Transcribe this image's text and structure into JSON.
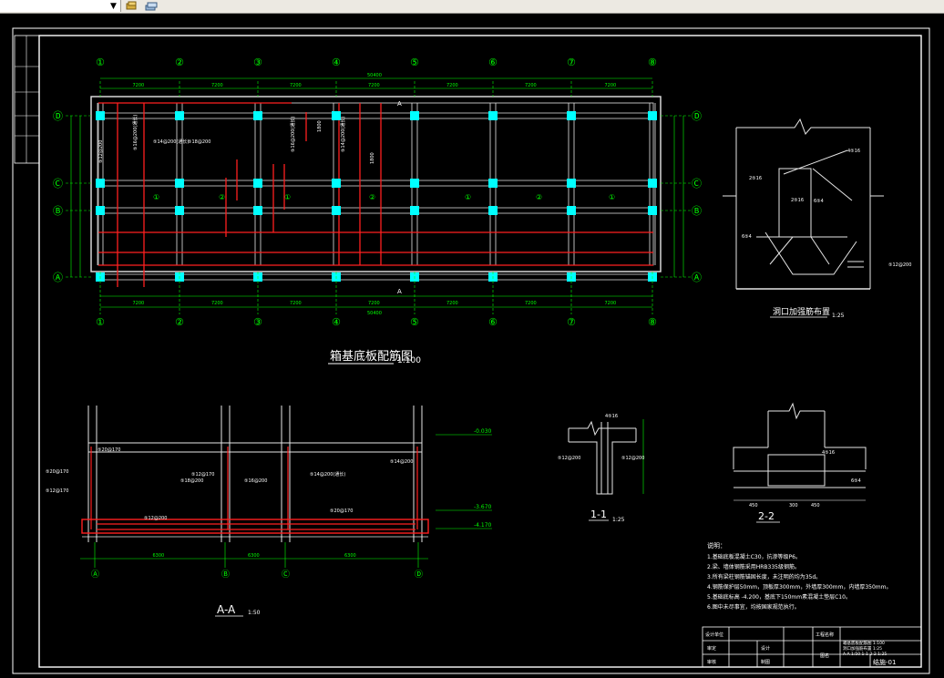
{
  "toolbar": {
    "combo_value": "",
    "icons": [
      "layer-icon",
      "layer-stack-icon"
    ]
  },
  "drawing": {
    "plan_title": "箱基底板配筋图",
    "plan_scale": "1:100",
    "axes_top": [
      "①",
      "②",
      "③",
      "④",
      "⑤",
      "⑥",
      "⑦",
      "⑧"
    ],
    "axes_side": [
      "Ⓓ",
      "Ⓒ",
      "Ⓑ",
      "Ⓐ"
    ],
    "plan_dims_top": [
      "7200",
      "7200",
      "7200",
      "7200",
      "7200",
      "7200",
      "7200"
    ],
    "plan_total_top": "50400",
    "plan_labels": [
      "⑤12@200",
      "⑤16@200(通长)",
      "⑤14@200(通长)",
      "⑤18@200",
      "⑤16@200(通长)",
      "⑤14@200(通长)",
      "1800",
      "1800"
    ],
    "panel_marks": [
      "①",
      "②",
      "①",
      "②",
      "①",
      "②",
      "①"
    ],
    "section_aa_title": "A-A",
    "section_aa_scale": "1:50",
    "section_aa_labels": [
      "⑤20@170",
      "⑤20@170",
      "⑤12@170",
      "⑤12@170",
      "⑤18@200",
      "⑤16@200",
      "⑤14@200(通长)",
      "⑤14@200",
      "⑤12@200",
      "⑤20@170"
    ],
    "section_aa_levels": [
      "-0.030",
      "-3.670",
      "-4.170"
    ],
    "section_aa_dims": [
      "6300",
      "6300",
      "6300"
    ],
    "section_aa_axes": [
      "Ⓐ",
      "Ⓑ",
      "Ⓒ",
      "Ⓓ"
    ],
    "detail_opening_title": "洞口加强筋布置",
    "detail_opening_scale": "1:25",
    "detail_opening_labels": [
      "4⑤16",
      "2⑤16",
      "2⑤16",
      "6⑤4",
      "6⑤4",
      "⑤12@200"
    ],
    "detail_11_title": "1-1",
    "detail_11_scale": "1:25",
    "detail_11_labels": [
      "4⑤16",
      "⑤12@200",
      "⑤12@200"
    ],
    "detail_22_title": "2-2",
    "detail_22_scale": "1:25",
    "detail_22_labels": [
      "4⑤16",
      "6⑤4"
    ],
    "detail_22_dims": [
      "450",
      "300",
      "450"
    ],
    "notes_title": "说明：",
    "notes": [
      "1.基础底板混凝土C30，抗渗等级P6。",
      "2.梁、墙体钢筋采用HRB335级钢筋。",
      "3.所有梁柱钢筋锚固长度，未注明的均为35d。",
      "4.钢筋保护层50mm，顶板厚300mm，外墙厚300mm，内墙厚350mm。",
      "5.基础底标高 -4.200，基底下150mm素混凝土垫层C10。",
      "6.图中未尽事宜，均按国家规范执行。"
    ],
    "titleblock": {
      "row1": [
        "设计单位",
        "",
        "",
        "工程名称"
      ],
      "row2": [
        "审定",
        "",
        "设计",
        "",
        "图名"
      ],
      "row3": [
        "审核",
        "",
        "制图",
        "",
        "",
        "图号"
      ],
      "drawing_name": [
        "箱基底板配筋图 1:100",
        "洞口加强筋布置 1:25",
        "A-A 1:50  1-1 2-2 1:25"
      ],
      "drawing_no": "结施-01"
    }
  },
  "colors": {
    "grid": "#e6e6e6",
    "axis": "#00ff00",
    "column": "#00ffff",
    "rebar": "#ff2020",
    "text": "#ffffff",
    "dim": "#00ff00",
    "level": "#00ff00"
  }
}
